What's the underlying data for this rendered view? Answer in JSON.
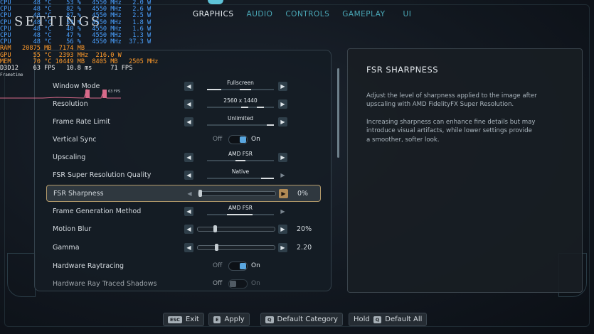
{
  "nav": {
    "tabs": [
      "GRAPHICS",
      "AUDIO",
      "CONTROLS",
      "GAMEPLAY",
      "UI"
    ]
  },
  "title": "SETTINGS",
  "settings": {
    "window_mode": {
      "label": "Window Mode",
      "value": "Fullscreen"
    },
    "resolution": {
      "label": "Resolution",
      "value": "2560 x 1440"
    },
    "frame_rate": {
      "label": "Frame Rate Limit",
      "value": "Unlimited"
    },
    "vsync": {
      "label": "Vertical Sync",
      "off": "Off",
      "on": "On",
      "state": "on"
    },
    "upscaling": {
      "label": "Upscaling",
      "value": "AMD FSR"
    },
    "fsr_quality": {
      "label": "FSR Super Resolution Quality",
      "value": "Native"
    },
    "fsr_sharpness": {
      "label": "FSR Sharpness",
      "value": "0%",
      "level": 0
    },
    "frame_gen": {
      "label": "Frame Generation Method",
      "value": "AMD FSR"
    },
    "motion_blur": {
      "label": "Motion Blur",
      "value": "20%",
      "level": 0.2
    },
    "gamma": {
      "label": "Gamma",
      "value": "2.20",
      "level": 0.22
    },
    "hw_raytracing": {
      "label": "Hardware Raytracing",
      "off": "Off",
      "on": "On",
      "state": "on"
    },
    "hw_rt_shadows": {
      "label": "Hardware Ray Traced Shadows",
      "off": "Off",
      "on": "On",
      "state": "off"
    }
  },
  "info": {
    "title": "FSR SHARPNESS",
    "p1": "Adjust the level of sharpness applied to the image after upscaling with AMD FidelityFX Super Resolution.",
    "p2": "Increasing sharpness can enhance fine details but may introduce visual artifacts, while lower settings provide a smoother, softer look."
  },
  "footer": {
    "exit": {
      "key": "ESC",
      "label": "Exit"
    },
    "apply": {
      "key": "E",
      "label": "Apply"
    },
    "default_cat": {
      "key": "Q",
      "label": "Default Category"
    },
    "default_all": {
      "pre": "Hold",
      "key": "Q",
      "label": "Default All"
    }
  },
  "overlay": {
    "lines": [
      {
        "cls": "c1",
        "t": "CPU      48 °C    53 %   4550 MHz   2.0 W"
      },
      {
        "cls": "c1",
        "t": "CPU      48 °C    82 %   4550 MHz   2.6 W"
      },
      {
        "cls": "c1",
        "t": "CPU      48 °C    87 %   4550 MHz   2.5 W"
      },
      {
        "cls": "c1",
        "t": "CPU      48 °C    53 %   4550 MHz   1.8 W"
      },
      {
        "cls": "c1",
        "t": "CPU      48 °C    40 %   4550 MHz   1.6 W"
      },
      {
        "cls": "c1",
        "t": "CPU      48 °C    47 %   4550 MHz   1.3 W"
      },
      {
        "cls": "c1",
        "t": "CPU      48 °C    56 %   4550 MHz  37.3 W"
      },
      {
        "cls": "c2",
        "t": "RAM   20875 MB  7174 MB"
      },
      {
        "cls": "c2",
        "t": "GPU      55 °C  2393 MHz  216.0 W"
      },
      {
        "cls": "c2",
        "t": "MEM      70 °C 10449 MB  8405 MB   2505 MHz"
      },
      {
        "cls": "c3",
        "t": "D3D12    63 FPS   10.8 ms     71 FPS"
      }
    ],
    "graph_label": "63 FPS",
    "frametime": "Frametime"
  }
}
